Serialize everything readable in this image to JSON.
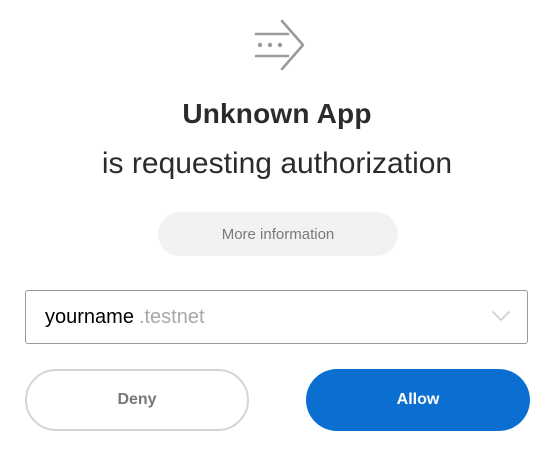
{
  "header": {
    "icon": "arrow-right-dotted-icon",
    "app_name": "Unknown App",
    "subtitle": "is requesting authorization"
  },
  "more_info": {
    "label": "More information"
  },
  "account": {
    "name": "yourname",
    "suffix": ".testnet",
    "dropdown_icon": "chevron-down-icon"
  },
  "actions": {
    "deny_label": "Deny",
    "allow_label": "Allow"
  },
  "colors": {
    "primary": "#0a6fd1",
    "text": "#2b2b2b",
    "muted": "#a8a8a8",
    "pill_bg": "#f2f2f2"
  }
}
